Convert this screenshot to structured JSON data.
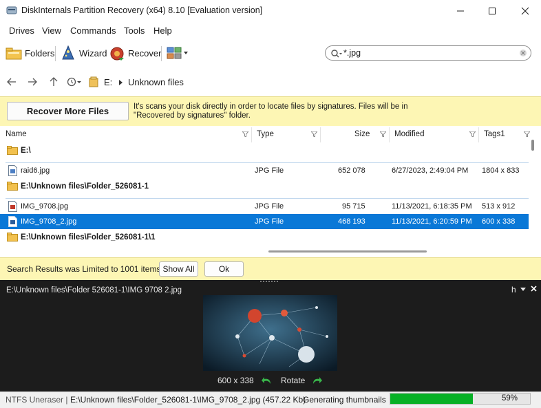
{
  "window": {
    "title": "DiskInternals Partition Recovery (x64) 8.10 [Evaluation version]"
  },
  "menu": [
    "Drives",
    "View",
    "Commands",
    "Tools",
    "Help"
  ],
  "toolbar": {
    "folders": "Folders",
    "wizard": "Wizard",
    "recover": "Recover"
  },
  "search": {
    "value": "*.jpg"
  },
  "breadcrumb": {
    "drive": "E:",
    "folder": "Unknown files"
  },
  "infobar": {
    "button": "Recover More Files",
    "text": "It's scans your disk directly in order to locate files by signatures. Files will be in \"Recovered by signatures\" folder."
  },
  "columns": {
    "name": "Name",
    "type": "Type",
    "size": "Size",
    "modified": "Modified",
    "tags": "Tags1"
  },
  "rows": [
    {
      "kind": "folder",
      "name": "E:\\"
    },
    {
      "kind": "file",
      "name": "raid6.jpg",
      "type": "JPG File",
      "size": "652 078",
      "modified": "6/27/2023, 2:49:04 PM",
      "tags": "1804 x 833"
    },
    {
      "kind": "folder",
      "name": "E:\\Unknown files\\Folder_526081-1"
    },
    {
      "kind": "file",
      "name": "IMG_9708.jpg",
      "type": "JPG File",
      "size": "95 715",
      "modified": "11/13/2021, 6:18:35 PM",
      "tags": "513 x 912"
    },
    {
      "kind": "file",
      "name": "IMG_9708_2.jpg",
      "type": "JPG File",
      "size": "468 193",
      "modified": "11/13/2021, 6:20:59 PM",
      "tags": "600 x 338",
      "selected": true
    },
    {
      "kind": "folder",
      "name": "E:\\Unknown files\\Folder_526081-1\\1"
    }
  ],
  "limitbar": {
    "text": "Search Results was Limited to 1001 items",
    "show_all": "Show All",
    "ok": "Ok"
  },
  "preview": {
    "path": "E:\\Unknown files\\Folder  526081-1\\IMG  9708  2.jpg",
    "dimensions": "600 x 338",
    "rotate": "Rotate",
    "mode": "h"
  },
  "status": {
    "left": "NTFS Uneraser |",
    "file": "E:\\Unknown files\\Folder_526081-1\\IMG_9708_2.jpg (457.22 Kb)",
    "task": "Generating thumbnails",
    "progress_label": "59%",
    "progress": 0.59
  },
  "colors": {
    "selection": "#0a78d7",
    "infobar": "#fdf6b4",
    "progress": "#06b025",
    "preview_bg": "#1c1c1c"
  }
}
